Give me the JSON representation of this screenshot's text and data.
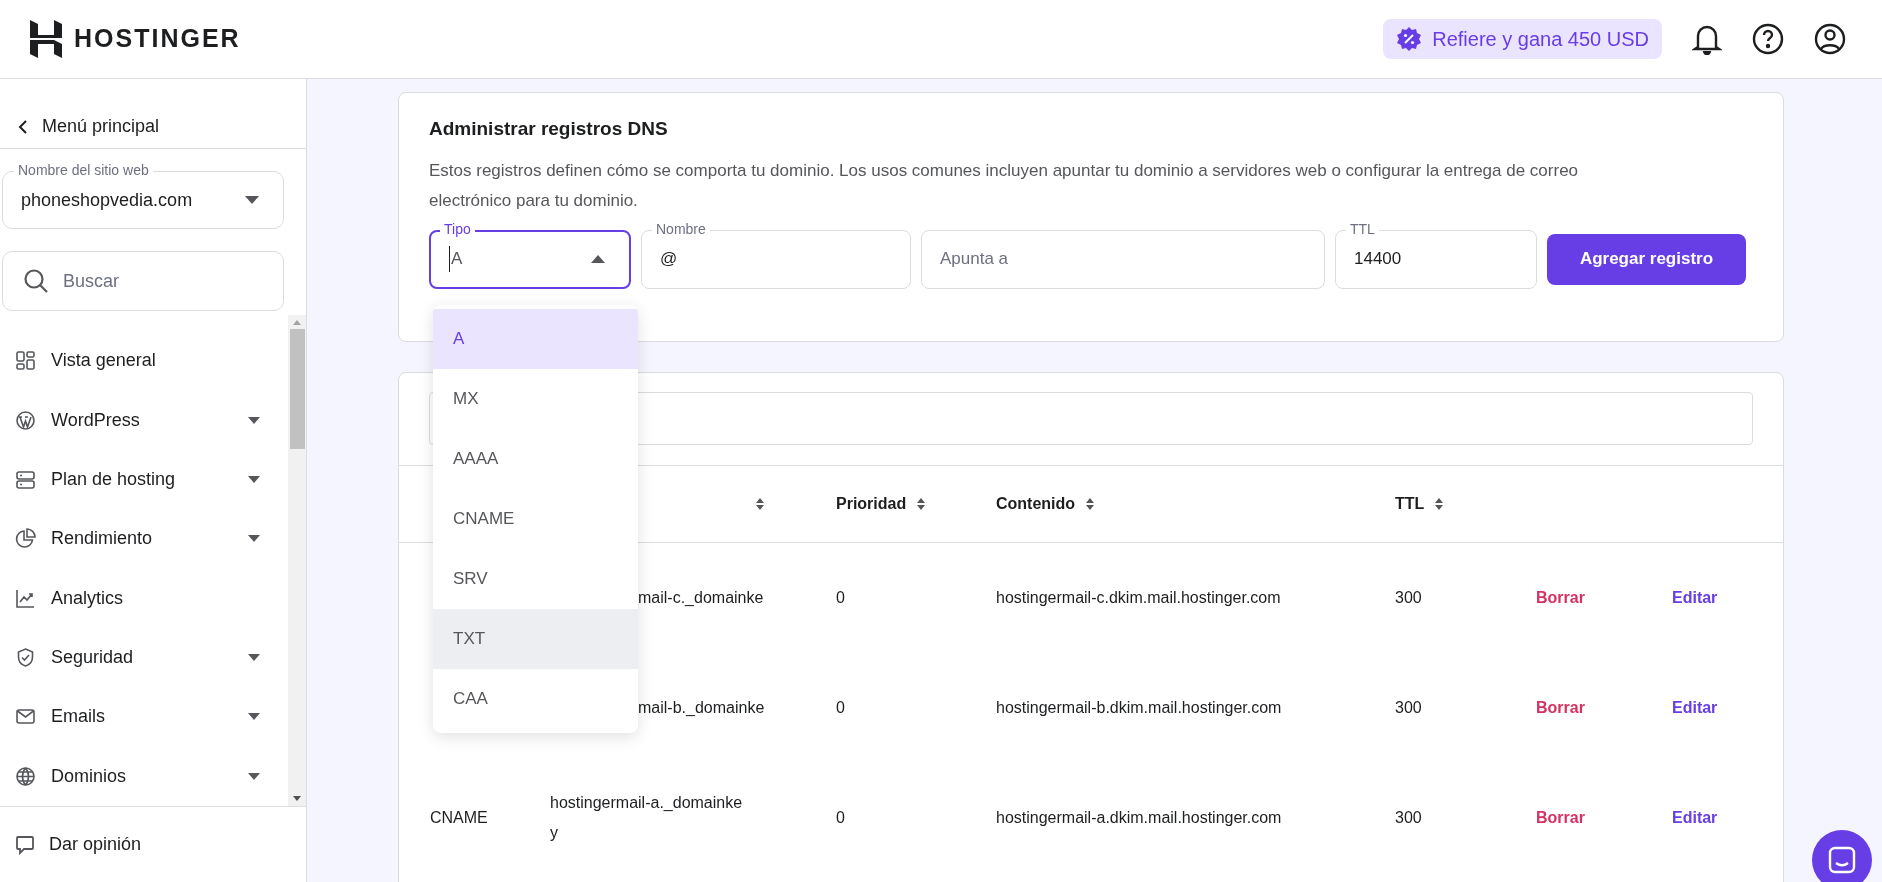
{
  "header": {
    "logo": "HOSTINGER",
    "referral": "Refiere y gana 450 USD"
  },
  "sidebar": {
    "back": "Menú principal",
    "site_select": {
      "label": "Nombre del sitio web",
      "value": "phoneshopvedia.com"
    },
    "search": {
      "placeholder": "Buscar"
    },
    "items": [
      {
        "label": "Vista general",
        "expandable": false
      },
      {
        "label": "WordPress",
        "expandable": true
      },
      {
        "label": "Plan de hosting",
        "expandable": true
      },
      {
        "label": "Rendimiento",
        "expandable": true
      },
      {
        "label": "Analytics",
        "expandable": false
      },
      {
        "label": "Seguridad",
        "expandable": true
      },
      {
        "label": "Emails",
        "expandable": true
      },
      {
        "label": "Dominios",
        "expandable": true
      }
    ],
    "footer": "Dar opinión"
  },
  "dns_card": {
    "title": "Administrar registros DNS",
    "description": "Estos registros definen cómo se comporta tu dominio. Los usos comunes incluyen apuntar tu dominio a servidores web o configurar la entrega de correo electrónico para tu dominio.",
    "type_field": {
      "label": "Tipo",
      "value": "A",
      "open": true
    },
    "name_field": {
      "label": "Nombre",
      "value": "@"
    },
    "target_field": {
      "placeholder": "Apunta a"
    },
    "ttl_field": {
      "label": "TTL",
      "value": "14400"
    },
    "add_button": "Agregar registro"
  },
  "type_options": [
    {
      "label": "A",
      "selected": true,
      "hovered": false
    },
    {
      "label": "MX",
      "selected": false,
      "hovered": false
    },
    {
      "label": "AAAA",
      "selected": false,
      "hovered": false
    },
    {
      "label": "CNAME",
      "selected": false,
      "hovered": false
    },
    {
      "label": "SRV",
      "selected": false,
      "hovered": false
    },
    {
      "label": "TXT",
      "selected": false,
      "hovered": true
    },
    {
      "label": "CAA",
      "selected": false,
      "hovered": false
    }
  ],
  "records_table": {
    "columns": [
      {
        "label": "Prioridad"
      },
      {
        "label": "Contenido"
      },
      {
        "label": "TTL"
      }
    ],
    "rows": [
      {
        "covered": true,
        "name_lines": [
          "mail-c._domainke"
        ],
        "priority": "0",
        "content": "hostingermail-c.dkim.mail.hostinger.com",
        "ttl": "300",
        "delete": "Borrar",
        "edit": "Editar"
      },
      {
        "covered": true,
        "name_lines": [
          "mail-b._domainke"
        ],
        "priority": "0",
        "content": "hostingermail-b.dkim.mail.hostinger.com",
        "ttl": "300",
        "delete": "Borrar",
        "edit": "Editar"
      },
      {
        "covered": false,
        "type": "CNAME",
        "name_lines": [
          "hostingermail-a._domainke",
          "y"
        ],
        "priority": "0",
        "content": "hostingermail-a.dkim.mail.hostinger.com",
        "ttl": "300",
        "delete": "Borrar",
        "edit": "Editar"
      }
    ]
  }
}
